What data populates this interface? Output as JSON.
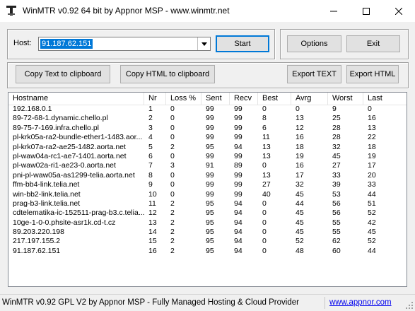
{
  "window": {
    "title": "WinMTR v0.92 64 bit by Appnor MSP - www.winmtr.net",
    "icon": "winmtr-app-icon",
    "minimize_icon": "minimize-icon",
    "maximize_icon": "maximize-icon",
    "close_icon": "close-icon"
  },
  "host": {
    "label": "Host:",
    "value": "91.187.62.151",
    "dropdown_icon": "chevron-down-icon"
  },
  "buttons": {
    "start": "Start",
    "options": "Options",
    "exit": "Exit",
    "copy_text": "Copy Text to clipboard",
    "copy_html": "Copy HTML to clipboard",
    "export_text": "Export TEXT",
    "export_html": "Export HTML"
  },
  "table": {
    "columns": [
      "Hostname",
      "Nr",
      "Loss %",
      "Sent",
      "Recv",
      "Best",
      "Avrg",
      "Worst",
      "Last"
    ],
    "rows": [
      [
        "192.168.0.1",
        "1",
        "0",
        "99",
        "99",
        "0",
        "0",
        "9",
        "0"
      ],
      [
        "89-72-68-1.dynamic.chello.pl",
        "2",
        "0",
        "99",
        "99",
        "8",
        "13",
        "25",
        "16"
      ],
      [
        "89-75-7-169.infra.chello.pl",
        "3",
        "0",
        "99",
        "99",
        "6",
        "12",
        "28",
        "13"
      ],
      [
        "pl-krk05a-ra2-bundle-ether1-1483.aor...",
        "4",
        "0",
        "99",
        "99",
        "11",
        "16",
        "28",
        "22"
      ],
      [
        "pl-krk07a-ra2-ae25-1482.aorta.net",
        "5",
        "2",
        "95",
        "94",
        "13",
        "18",
        "32",
        "18"
      ],
      [
        "pl-waw04a-rc1-ae7-1401.aorta.net",
        "6",
        "0",
        "99",
        "99",
        "13",
        "19",
        "45",
        "19"
      ],
      [
        "pl-waw02a-ri1-ae23-0.aorta.net",
        "7",
        "3",
        "91",
        "89",
        "0",
        "16",
        "27",
        "17"
      ],
      [
        "pni-pl-waw05a-as1299-telia.aorta.net",
        "8",
        "0",
        "99",
        "99",
        "13",
        "17",
        "33",
        "20"
      ],
      [
        "ffm-bb4-link.telia.net",
        "9",
        "0",
        "99",
        "99",
        "27",
        "32",
        "39",
        "33"
      ],
      [
        "win-bb2-link.telia.net",
        "10",
        "0",
        "99",
        "99",
        "40",
        "45",
        "53",
        "44"
      ],
      [
        "prag-b3-link.telia.net",
        "11",
        "2",
        "95",
        "94",
        "0",
        "44",
        "56",
        "51"
      ],
      [
        "cdtelematika-ic-152511-prag-b3.c.telia...",
        "12",
        "2",
        "95",
        "94",
        "0",
        "45",
        "56",
        "52"
      ],
      [
        "10ge-1-0-0.phsite-asr1k.cd-t.cz",
        "13",
        "2",
        "95",
        "94",
        "0",
        "45",
        "55",
        "42"
      ],
      [
        "89.203.220.198",
        "14",
        "2",
        "95",
        "94",
        "0",
        "45",
        "55",
        "45"
      ],
      [
        "217.197.155.2",
        "15",
        "2",
        "95",
        "94",
        "0",
        "52",
        "62",
        "52"
      ],
      [
        "91.187.62.151",
        "16",
        "2",
        "95",
        "94",
        "0",
        "48",
        "60",
        "44"
      ]
    ]
  },
  "status": {
    "text": "WinMTR v0.92 GPL V2 by Appnor MSP - Fully Managed Hosting & Cloud Provider",
    "link": "www.appnor.com",
    "grip_icon": "resize-grip-icon"
  }
}
